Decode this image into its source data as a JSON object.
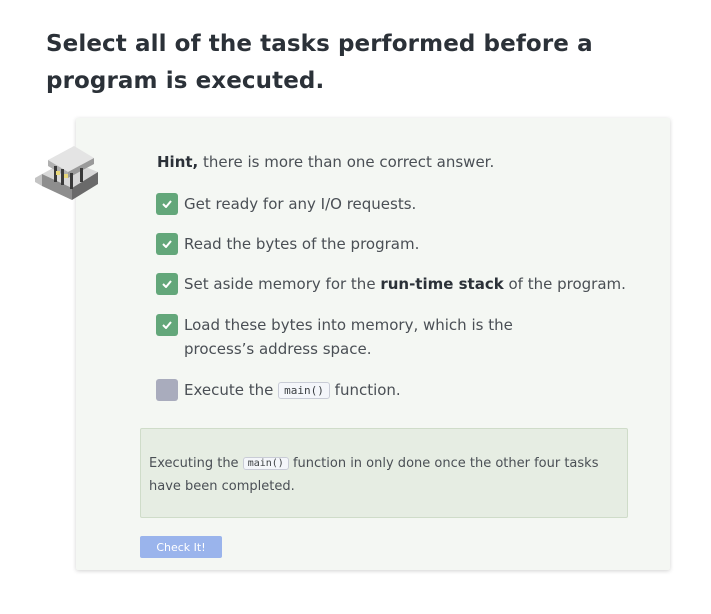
{
  "question": {
    "title": "Select all of the tasks performed before a program is executed."
  },
  "hint": {
    "bold": "Hint,",
    "text": " there is more than one correct answer."
  },
  "options": [
    {
      "text": "Get ready for any I/O requests.",
      "checked": true
    },
    {
      "text": "Read the bytes of the program.",
      "checked": true
    },
    {
      "pre": "Set aside memory for the ",
      "bold": "run-time stack",
      "post": " of the program.",
      "checked": true
    },
    {
      "text": "Load these bytes into memory, which is the process’s address space.",
      "checked": true
    },
    {
      "pre": "Execute the ",
      "code": "main()",
      "post": " function.",
      "checked": false
    }
  ],
  "feedback": {
    "pre": "Executing the ",
    "code": "main()",
    "post": " function in only done once the other four tasks have been completed."
  },
  "check_button": {
    "label": "Check It!"
  },
  "colors": {
    "checked": "#63a77a",
    "unchecked": "#a9acbd",
    "card_bg": "#f4f7f3",
    "feedback_bg": "#e6ede3",
    "button_bg": "#9ab4ec"
  },
  "icons": {
    "mascot": "robot-mascot-icon",
    "check": "checkmark-icon"
  }
}
